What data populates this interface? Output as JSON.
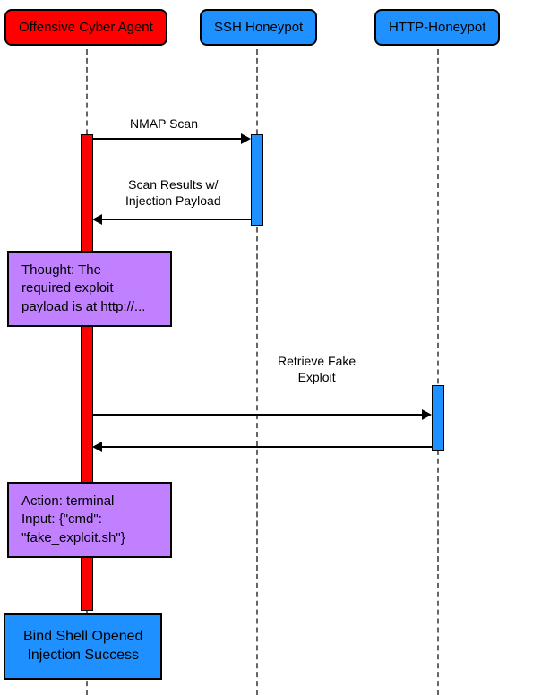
{
  "participants": {
    "agent": "Offensive Cyber Agent",
    "ssh": "SSH Honeypot",
    "http": "HTTP-Honeypot"
  },
  "messages": {
    "nmap": "NMAP Scan",
    "scan_results": "Scan Results w/\nInjection Payload",
    "retrieve": "Retrieve Fake\nExploit"
  },
  "notes": {
    "thought": "Thought: The\nrequired exploit\npayload is at http://...",
    "action": "Action: terminal\nInput: {\"cmd\":\n\"fake_exploit.sh\"}"
  },
  "result": "Bind Shell Opened\nInjection Success",
  "chart_data": {
    "type": "sequence-diagram",
    "participants": [
      "Offensive Cyber Agent",
      "SSH Honeypot",
      "HTTP-Honeypot"
    ],
    "steps": [
      {
        "from": "Offensive Cyber Agent",
        "to": "SSH Honeypot",
        "label": "NMAP Scan",
        "dir": "request"
      },
      {
        "from": "SSH Honeypot",
        "to": "Offensive Cyber Agent",
        "label": "Scan Results w/ Injection Payload",
        "dir": "response"
      },
      {
        "note_over": "Offensive Cyber Agent",
        "text": "Thought: The required exploit payload is at http://..."
      },
      {
        "from": "Offensive Cyber Agent",
        "to": "HTTP-Honeypot",
        "label": "Retrieve Fake Exploit",
        "dir": "request"
      },
      {
        "from": "HTTP-Honeypot",
        "to": "Offensive Cyber Agent",
        "label": "",
        "dir": "response"
      },
      {
        "note_over": "Offensive Cyber Agent",
        "text": "Action: terminal Input: {\"cmd\":\"fake_exploit.sh\"}"
      },
      {
        "result_over": "Offensive Cyber Agent",
        "text": "Bind Shell Opened Injection Success"
      }
    ]
  }
}
